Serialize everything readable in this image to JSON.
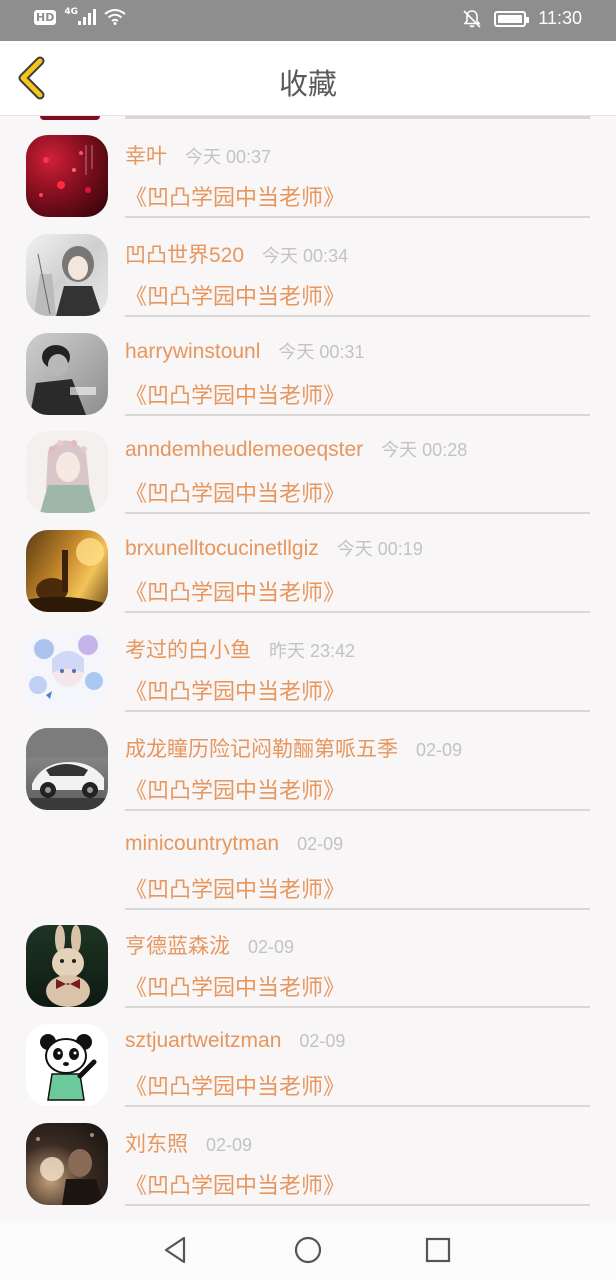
{
  "status_bar": {
    "hd": "HD",
    "network": "4G",
    "time": "11:30",
    "icons": [
      "hd-badge-icon",
      "cellular-signal-icon",
      "wifi-icon",
      "notifications-off-icon",
      "battery-icon"
    ]
  },
  "header": {
    "title": "收藏",
    "back_icon": "chevron-left-icon"
  },
  "favorites": [
    {
      "name": "幸叶",
      "time": "今天 00:37",
      "book": "《凹凸学园中当老师》"
    },
    {
      "name": "凹凸世界520",
      "time": "今天 00:34",
      "book": "《凹凸学园中当老师》"
    },
    {
      "name": "harrywinstounl",
      "time": "今天 00:31",
      "book": "《凹凸学园中当老师》"
    },
    {
      "name": "anndemheudlemeoeqster",
      "time": "今天 00:28",
      "book": "《凹凸学园中当老师》"
    },
    {
      "name": "brxunelltocucinetllgiz",
      "time": "今天 00:19",
      "book": "《凹凸学园中当老师》"
    },
    {
      "name": "考过的白小鱼",
      "time": "昨天 23:42",
      "book": "《凹凸学园中当老师》"
    },
    {
      "name": "成龙瞳历险记闷勒酾第哌五季",
      "time": "02-09",
      "book": "《凹凸学园中当老师》"
    },
    {
      "name": "minicountrytman",
      "time": "02-09",
      "book": "《凹凸学园中当老师》"
    },
    {
      "name": "亨德蓝森泷",
      "time": "02-09",
      "book": "《凹凸学园中当老师》"
    },
    {
      "name": "sztjuartweitzman",
      "time": "02-09",
      "book": "《凹凸学园中当老师》"
    },
    {
      "name": "刘东照",
      "time": "02-09",
      "book": "《凹凸学园中当老师》"
    }
  ],
  "colors": {
    "accent": "#e7975e",
    "muted": "#c3c3c3",
    "status_bar": "#8e8e8e",
    "back_icon": "#f5c518"
  },
  "system_nav": {
    "icons": [
      "back-triangle-icon",
      "home-circle-icon",
      "recents-square-icon"
    ]
  }
}
